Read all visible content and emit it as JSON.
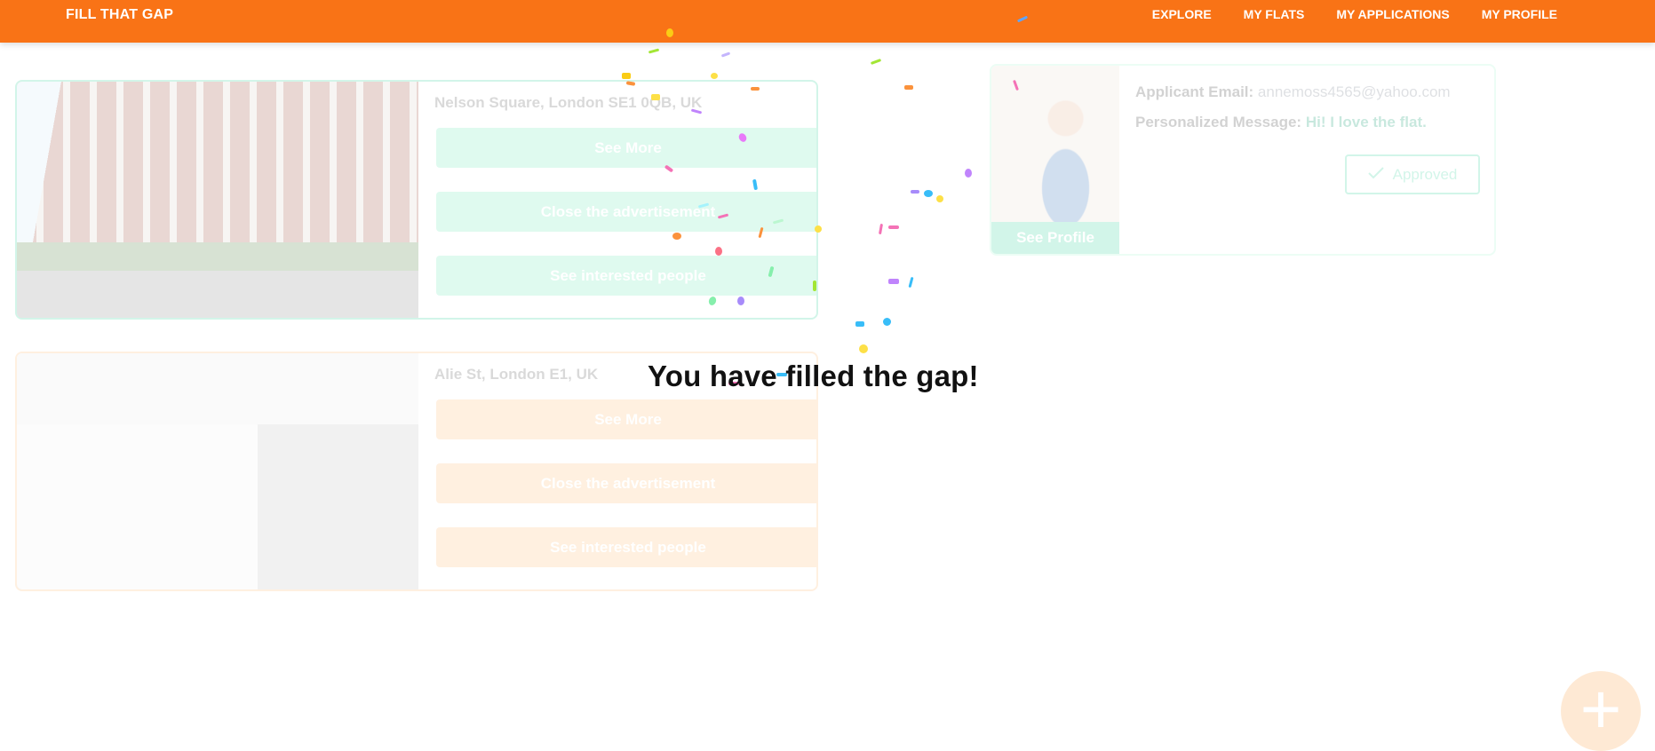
{
  "brand": "FILL THAT GAP",
  "nav": [
    "EXPLORE",
    "MY FLATS",
    "MY APPLICATIONS",
    "MY PROFILE"
  ],
  "flats": [
    {
      "address": "Nelson Square, London SE1 0QB, UK",
      "accent": "#34d399",
      "buttons": [
        "See More",
        "Close the advertisement",
        "See interested people"
      ]
    },
    {
      "address": "Alie St, London E1, UK",
      "accent": "#fdba74",
      "buttons": [
        "See More",
        "Close the advertisement",
        "See interested people"
      ]
    }
  ],
  "application": {
    "see_profile": "See Profile",
    "email_label": "Applicant Email:",
    "email": "annemoss4565@yahoo.com",
    "message_label": "Personalized Message:",
    "message": "Hi! I love the flat.",
    "status": "Approved",
    "status_icon": "check-icon"
  },
  "overlay": {
    "headline": "You have filled the gap!"
  },
  "fab_icon": "plus-icon",
  "colors": {
    "primary": "#f97316",
    "success": "#34d399"
  }
}
